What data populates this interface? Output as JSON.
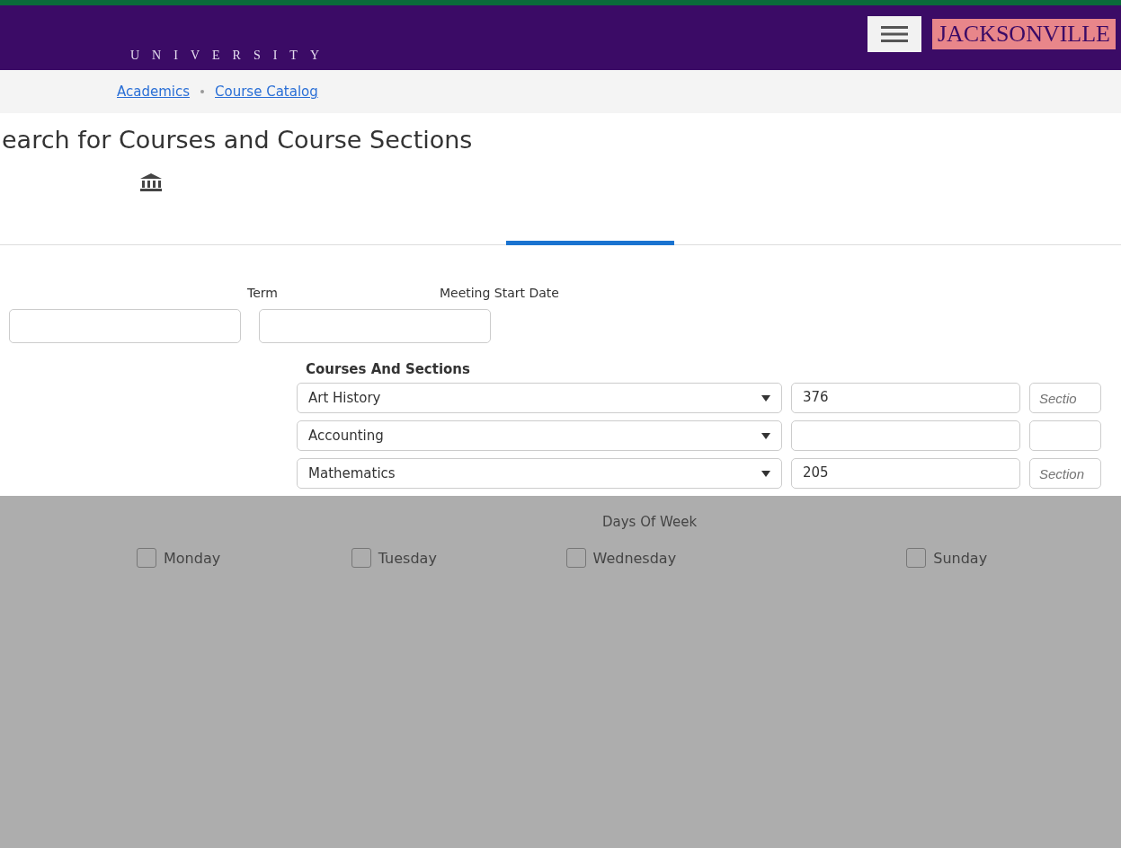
{
  "header": {
    "wordmark": "JACKSONVILLE",
    "subtitle": "UNIVERSITY"
  },
  "breadcrumb": [
    {
      "label": "Academics"
    },
    {
      "label": "Course Catalog"
    }
  ],
  "page_title": "earch for Courses and Course Sections",
  "filters": {
    "labels": [
      {
        "label": "Term"
      },
      {
        "label": "Meeting Start Date"
      }
    ]
  },
  "courses": {
    "heading": "Courses And Sections",
    "rows": [
      {
        "subject": "Art History",
        "number": "376",
        "section_placeholder": "Sectio"
      },
      {
        "subject": "Accounting",
        "number": "",
        "section_placeholder": ""
      },
      {
        "subject": "Mathematics",
        "number": "205",
        "section_placeholder": "Section"
      }
    ]
  },
  "days": {
    "heading": "Days Of Week",
    "items": [
      {
        "label": "Monday",
        "checked": false
      },
      {
        "label": "Tuesday",
        "checked": false
      },
      {
        "label": "Wednesday",
        "checked": false
      },
      {
        "label": "Sunday",
        "checked": false
      }
    ]
  }
}
